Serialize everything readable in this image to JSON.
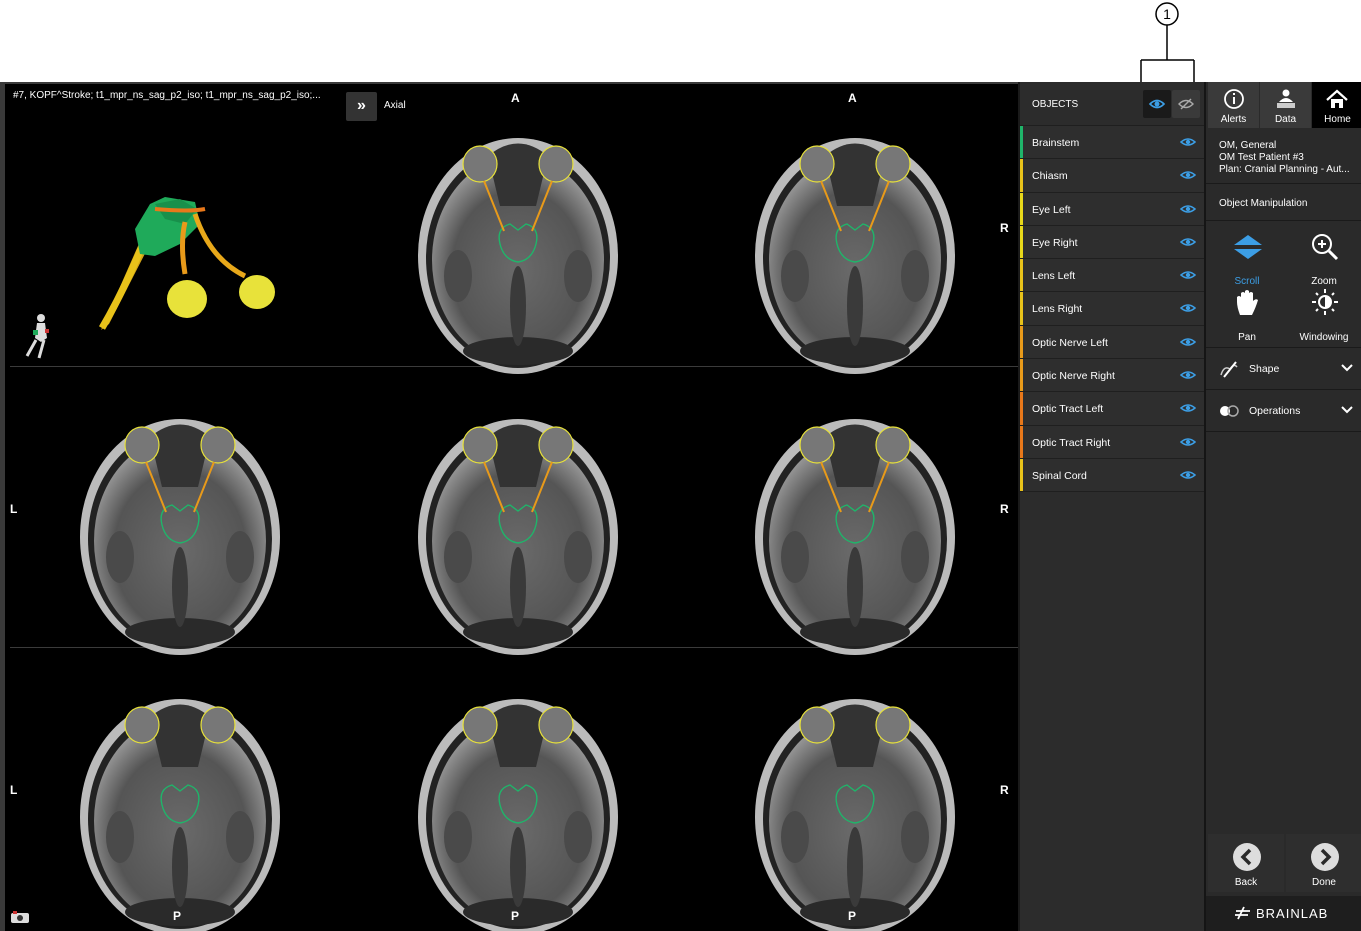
{
  "callout": {
    "number": "1"
  },
  "viewer": {
    "series_title": "#7, KOPF^Stroke; t1_mpr_ns_sag_p2_iso; t1_mpr_ns_sag_p2_iso;...",
    "view_label": "Axial",
    "orientation": {
      "anterior": "A",
      "posterior": "P",
      "left": "L",
      "right": "R"
    }
  },
  "objects": {
    "title": "OBJECTS",
    "items": [
      {
        "label": "Brainstem",
        "color": "#1fb56a"
      },
      {
        "label": "Chiasm",
        "color": "#e8c21a"
      },
      {
        "label": "Eye Left",
        "color": "#e8d81a"
      },
      {
        "label": "Eye Right",
        "color": "#e8d81a"
      },
      {
        "label": "Lens Left",
        "color": "#e8c21a"
      },
      {
        "label": "Lens Right",
        "color": "#e8c21a"
      },
      {
        "label": "Optic Nerve Left",
        "color": "#e89a1a"
      },
      {
        "label": "Optic Nerve Right",
        "color": "#e89a1a"
      },
      {
        "label": "Optic Tract Left",
        "color": "#e8781a"
      },
      {
        "label": "Optic Tract Right",
        "color": "#e8781a"
      },
      {
        "label": "Spinal Cord",
        "color": "#e8c21a"
      }
    ]
  },
  "topnav": {
    "alerts": "Alerts",
    "data": "Data",
    "home": "Home"
  },
  "patient": {
    "line1": "OM, General",
    "line2": "OM Test Patient #3",
    "line3": "Plan: Cranial Planning - Aut..."
  },
  "section_title": "Object Manipulation",
  "tools": {
    "scroll": "Scroll",
    "zoom": "Zoom",
    "pan": "Pan",
    "windowing": "Windowing"
  },
  "accordion": {
    "shape": "Shape",
    "operations": "Operations"
  },
  "nav": {
    "back": "Back",
    "done": "Done"
  },
  "brand": "BRAINLAB",
  "colors": {
    "accent": "#3c9ee5",
    "brainstem": "#1fb56a",
    "eye": "#e8d81a",
    "nerve": "#e89a1a"
  }
}
